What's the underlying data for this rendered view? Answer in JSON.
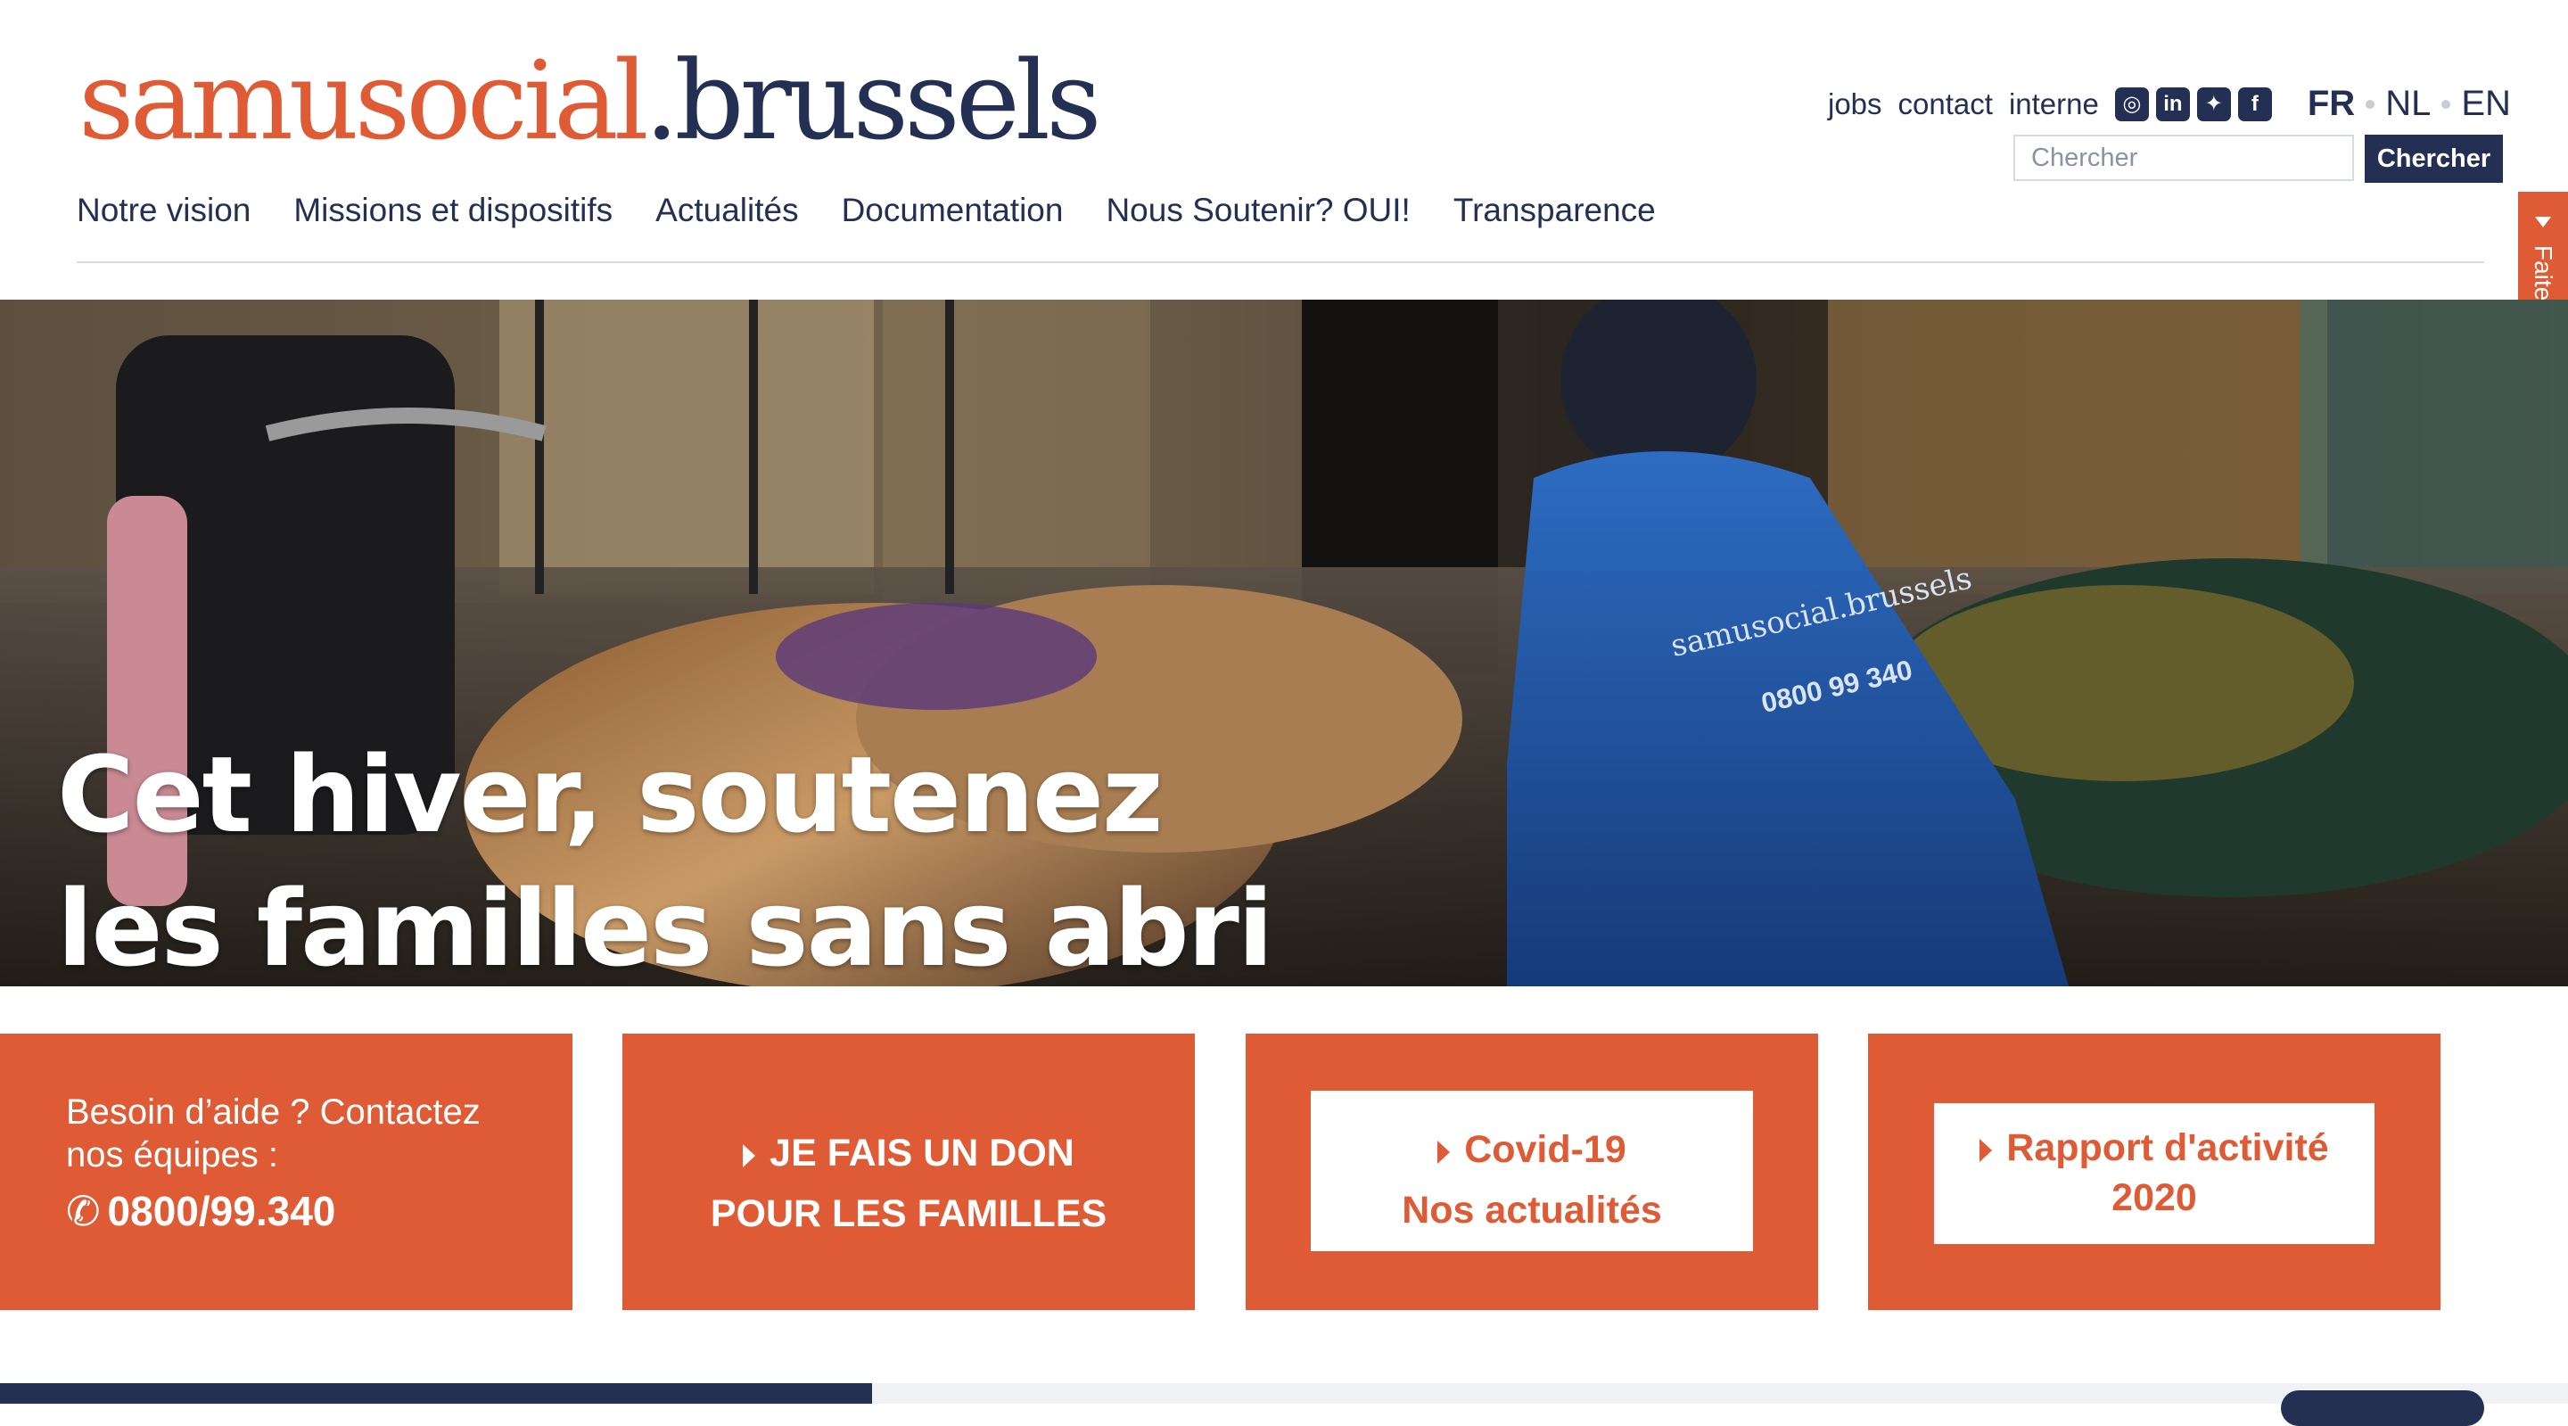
{
  "logo": {
    "part1": "samusocial",
    "part2": ".brussels"
  },
  "top_links": {
    "jobs": "jobs",
    "contact": "contact",
    "interne": "interne"
  },
  "social": [
    {
      "icon": "instagram-icon",
      "glyph": "◎"
    },
    {
      "icon": "linkedin-icon",
      "glyph": "in"
    },
    {
      "icon": "twitter-icon",
      "glyph": "✦"
    },
    {
      "icon": "facebook-icon",
      "glyph": "f"
    }
  ],
  "languages": {
    "fr": "FR",
    "nl": "NL",
    "en": "EN",
    "active": "FR"
  },
  "search": {
    "placeholder": "Chercher",
    "button": "Chercher"
  },
  "nav": [
    "Notre vision",
    "Missions et dispositifs",
    "Actualités",
    "Documentation",
    "Nous Soutenir? OUI!",
    "Transparence"
  ],
  "donate_tab": "Faites un don",
  "hero": {
    "line1": "Cet hiver, soutenez",
    "line2": "les familles sans abri",
    "jacket_logo": "samusocial.brussels",
    "jacket_phone": "0800 99 340"
  },
  "cards": {
    "help_line1": "Besoin d’aide ? Contactez",
    "help_line2": "nos équipes :",
    "help_phone": "0800/99.340",
    "donate_line1": "JE FAIS UN DON",
    "donate_line2": "POUR LES FAMILLES",
    "covid_line1": "Covid-19",
    "covid_line2": "Nos actualités",
    "report_line1": "Rapport d'activité",
    "report_line2": "2020"
  },
  "colors": {
    "brand_orange": "#df5b35",
    "brand_navy": "#233053"
  }
}
